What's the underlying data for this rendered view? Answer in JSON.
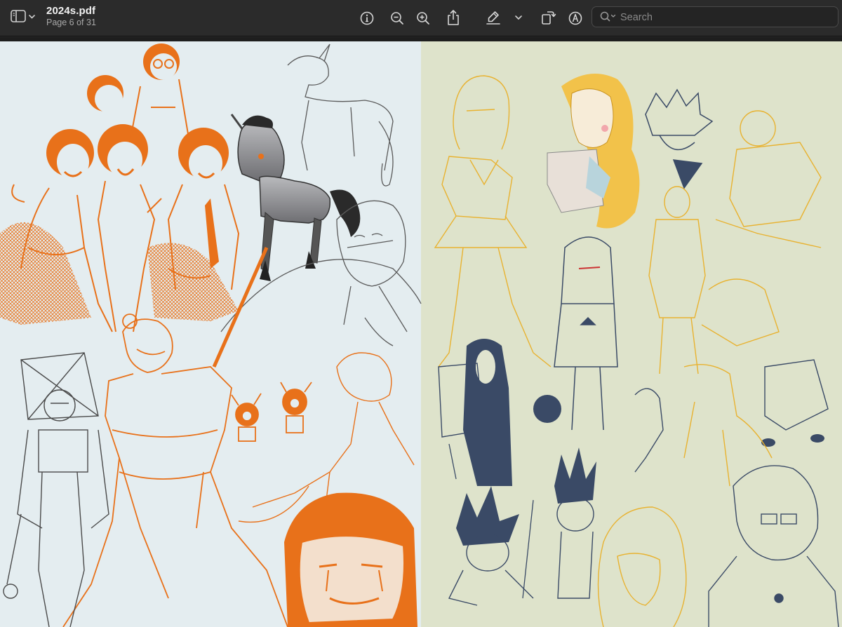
{
  "window": {
    "document_title": "2024s.pdf",
    "page_indicator": "Page 6 of 31"
  },
  "toolbar": {
    "buttons": [
      {
        "name": "sidebar-toggle",
        "icon": "sidebar-icon"
      },
      {
        "name": "info",
        "icon": "info-icon"
      },
      {
        "name": "zoom-out",
        "icon": "zoom-out-icon"
      },
      {
        "name": "zoom-in",
        "icon": "zoom-in-icon"
      },
      {
        "name": "share",
        "icon": "share-icon"
      },
      {
        "name": "highlight",
        "icon": "highlighter-icon"
      },
      {
        "name": "highlight-options",
        "icon": "chevron-down-icon"
      },
      {
        "name": "rotate",
        "icon": "rotate-icon"
      },
      {
        "name": "markup",
        "icon": "markup-pen-icon"
      }
    ],
    "search": {
      "placeholder": "Search",
      "value": ""
    }
  },
  "document_page": {
    "content": "sketchbook page",
    "colors": {
      "left_bg": "#e4edf0",
      "right_bg": "#dee3cb",
      "orange": "#e8711a",
      "yellow": "#e8b230",
      "navy": "#3a4a66",
      "graphite": "#4a4a4a"
    }
  }
}
